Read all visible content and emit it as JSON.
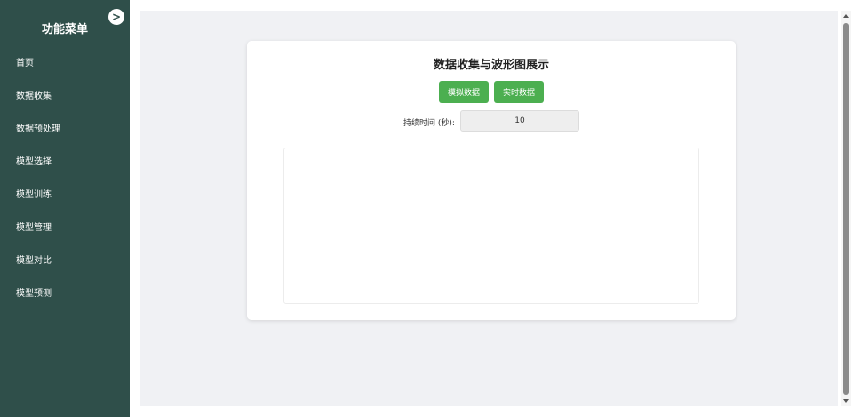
{
  "sidebar": {
    "title": "功能菜单",
    "toggle_label": ">",
    "items": [
      {
        "label": "首页"
      },
      {
        "label": "数据收集"
      },
      {
        "label": "数据预处理"
      },
      {
        "label": "模型选择"
      },
      {
        "label": "模型训练"
      },
      {
        "label": "模型管理"
      },
      {
        "label": "模型对比"
      },
      {
        "label": "模型预测"
      }
    ]
  },
  "main": {
    "title": "数据收集与波形图展示",
    "buttons": {
      "simulate": "模拟数据",
      "realtime": "实时数据"
    },
    "duration": {
      "label": "持续时间 (秒):",
      "value": "10"
    }
  },
  "colors": {
    "sidebar_bg": "#2f4f4a",
    "button_green": "#4caf50",
    "main_bg": "#f0f1f4"
  }
}
